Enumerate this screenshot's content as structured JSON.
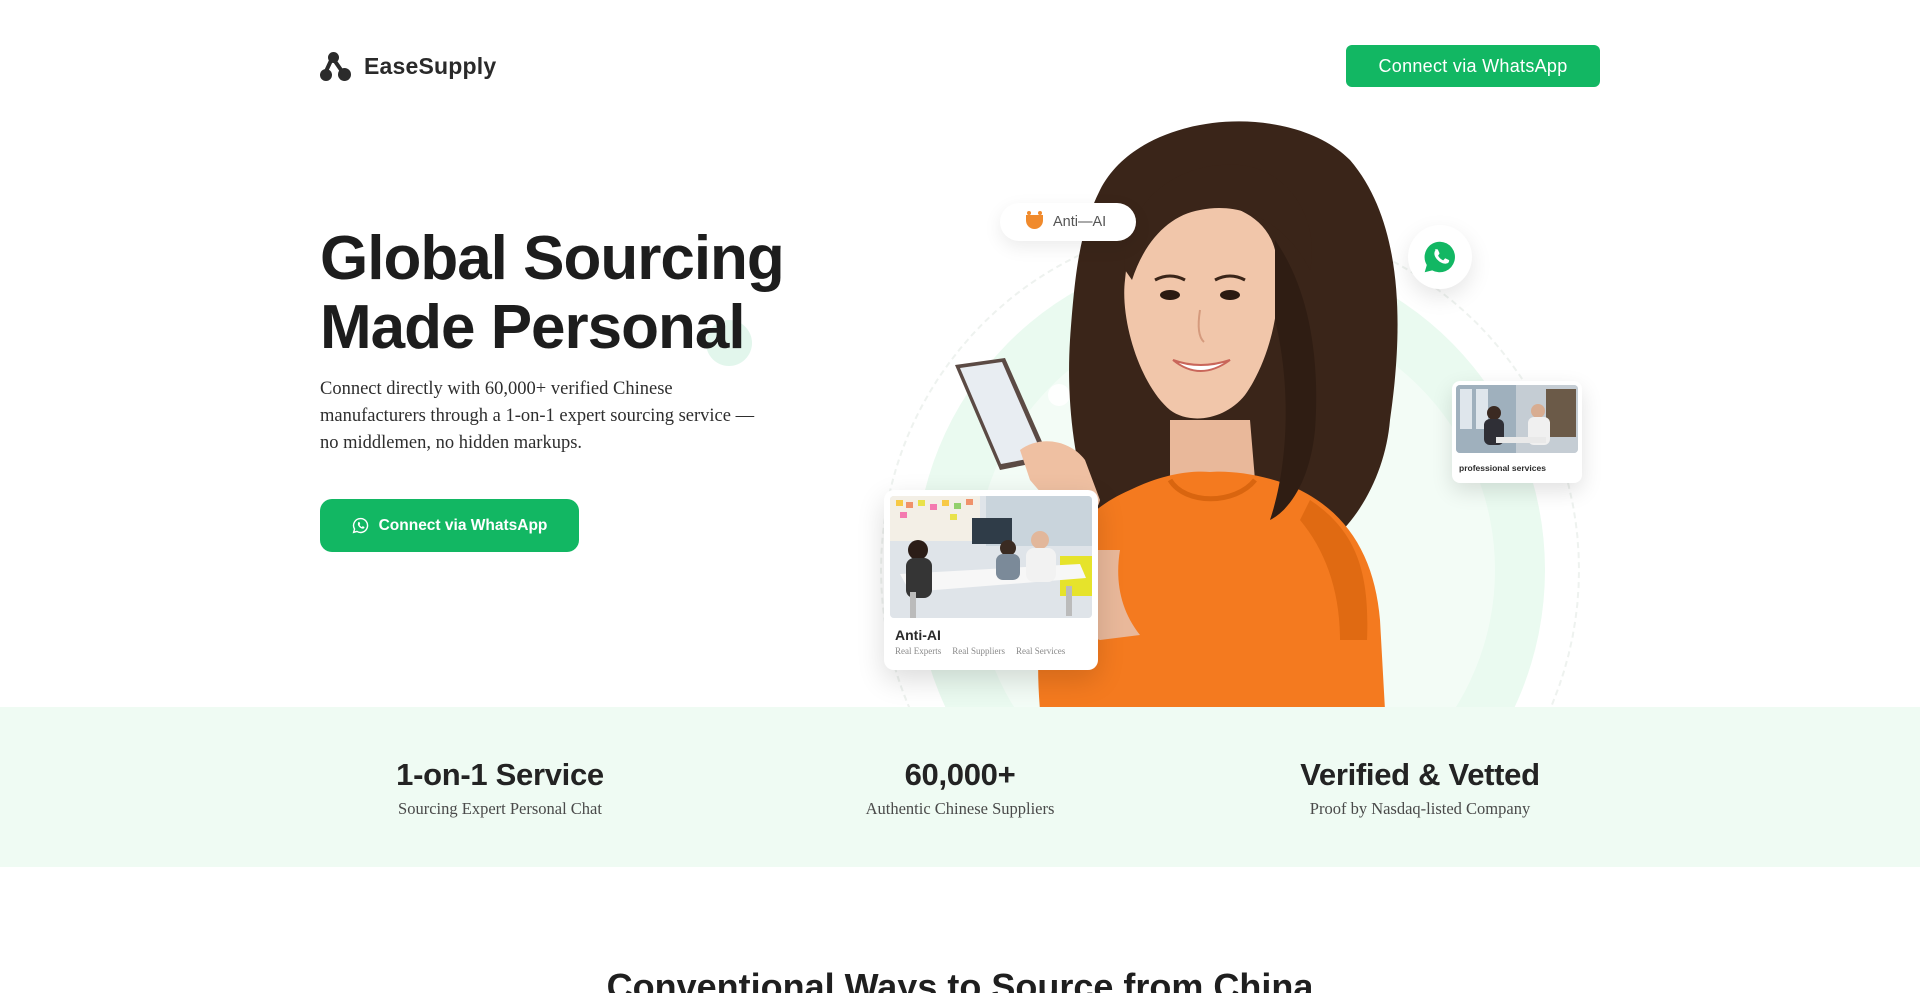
{
  "brand": {
    "name": "EaseSupply"
  },
  "header": {
    "cta_label": "Connect via WhatsApp"
  },
  "hero": {
    "title_line1": "Global Sourcing",
    "title_line2": "Made Personal",
    "description": "Connect directly with 60,000+ verified Chinese manufacturers through a 1-on-1 expert sourcing service — no middlemen, no hidden markups.",
    "cta_label": "Connect via WhatsApp"
  },
  "visual": {
    "pill_label": "Anti—AI",
    "card": {
      "title": "Anti-AI",
      "tags": [
        "Real Experts",
        "Real Suppliers",
        "Real Services"
      ]
    },
    "small_card_label": "professional services"
  },
  "stats": [
    {
      "value": "1-on-1 Service",
      "label": "Sourcing Expert Personal Chat"
    },
    {
      "value": "60,000+",
      "label": "Authentic Chinese Suppliers"
    },
    {
      "value": "Verified & Vetted",
      "label": "Proof by Nasdaq-listed Company"
    }
  ],
  "next_section": {
    "title": "Conventional Ways to Source from China"
  },
  "colors": {
    "accent": "#12b763",
    "band": "#effbf3",
    "shirt": "#f47a1f"
  }
}
